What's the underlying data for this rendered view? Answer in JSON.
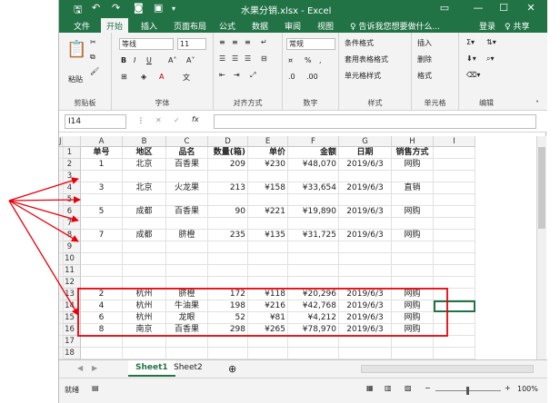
{
  "window": {
    "title": "水果分销.xlsx - Excel"
  },
  "tabs": [
    "文件",
    "开始",
    "插入",
    "页面布局",
    "公式",
    "数据",
    "审阅",
    "视图"
  ],
  "tell_me": "♀ 告诉我您想要做什么...",
  "login": "登录",
  "share": "♀ 共享",
  "ribbon": {
    "clipboard": {
      "label": "剪贴板",
      "paste": "粘贴"
    },
    "font": {
      "label": "字体",
      "name": "等线",
      "size": "11"
    },
    "alignment": {
      "label": "对齐方式"
    },
    "number": {
      "label": "数字",
      "format": "常规"
    },
    "styles": {
      "label": "样式",
      "cond": "条件格式",
      "table": "套用表格格式",
      "cell": "单元格样式"
    },
    "cells": {
      "label": "单元格",
      "insert": "插入",
      "delete": "删除",
      "format": "格式"
    },
    "editing": {
      "label": "编辑"
    }
  },
  "namebox": "I14",
  "columns": [
    "A",
    "B",
    "C",
    "D",
    "E",
    "F",
    "G",
    "H",
    "I",
    "J"
  ],
  "rows": [
    {
      "n": "1",
      "cells": [
        "单号",
        "地区",
        "品名",
        "数量(箱)",
        "单价",
        "金额",
        "日期",
        "销售方式"
      ]
    },
    {
      "n": "2",
      "cells": [
        "1",
        "北京",
        "百香果",
        "209",
        "¥230",
        "¥48,070",
        "2019/6/3",
        "网购"
      ]
    },
    {
      "n": "3",
      "cells": [
        "",
        "",
        "",
        "",
        "",
        "",
        "",
        ""
      ]
    },
    {
      "n": "4",
      "cells": [
        "3",
        "北京",
        "火龙果",
        "213",
        "¥158",
        "¥33,654",
        "2019/6/3",
        "直销"
      ]
    },
    {
      "n": "5",
      "cells": [
        "",
        "",
        "",
        "",
        "",
        "",
        "",
        ""
      ]
    },
    {
      "n": "6",
      "cells": [
        "5",
        "成都",
        "百香果",
        "90",
        "¥221",
        "¥19,890",
        "2019/6/3",
        "网购"
      ]
    },
    {
      "n": "7",
      "cells": [
        "",
        "",
        "",
        "",
        "",
        "",
        "",
        ""
      ]
    },
    {
      "n": "8",
      "cells": [
        "7",
        "成都",
        "脐橙",
        "235",
        "¥135",
        "¥31,725",
        "2019/6/3",
        "网购"
      ]
    },
    {
      "n": "9",
      "cells": [
        "",
        "",
        "",
        "",
        "",
        "",
        "",
        ""
      ]
    },
    {
      "n": "10",
      "cells": [
        "",
        "",
        "",
        "",
        "",
        "",
        "",
        ""
      ]
    },
    {
      "n": "11",
      "cells": [
        "",
        "",
        "",
        "",
        "",
        "",
        "",
        ""
      ]
    },
    {
      "n": "12",
      "cells": [
        "",
        "",
        "",
        "",
        "",
        "",
        "",
        ""
      ]
    },
    {
      "n": "13",
      "cells": [
        "2",
        "杭州",
        "脐橙",
        "172",
        "¥118",
        "¥20,296",
        "2019/6/3",
        "网购"
      ]
    },
    {
      "n": "14",
      "cells": [
        "4",
        "杭州",
        "牛油果",
        "198",
        "¥216",
        "¥42,768",
        "2019/6/3",
        "网购"
      ]
    },
    {
      "n": "15",
      "cells": [
        "6",
        "杭州",
        "龙眼",
        "52",
        "¥81",
        "¥4,212",
        "2019/6/3",
        "网购"
      ]
    },
    {
      "n": "16",
      "cells": [
        "8",
        "南京",
        "百香果",
        "298",
        "¥265",
        "¥78,970",
        "2019/6/3",
        "网购"
      ]
    },
    {
      "n": "17",
      "cells": [
        "",
        "",
        "",
        "",
        "",
        "",
        "",
        ""
      ]
    },
    {
      "n": "18",
      "cells": [
        "",
        "",
        "",
        "",
        "",
        "",
        "",
        ""
      ]
    }
  ],
  "sheets": [
    "Sheet1",
    "Sheet2"
  ],
  "status": {
    "mode": "就绪",
    "zoom": "100%"
  },
  "colors": {
    "excel_green": "#217346",
    "annotation_red": "#e8000b"
  }
}
